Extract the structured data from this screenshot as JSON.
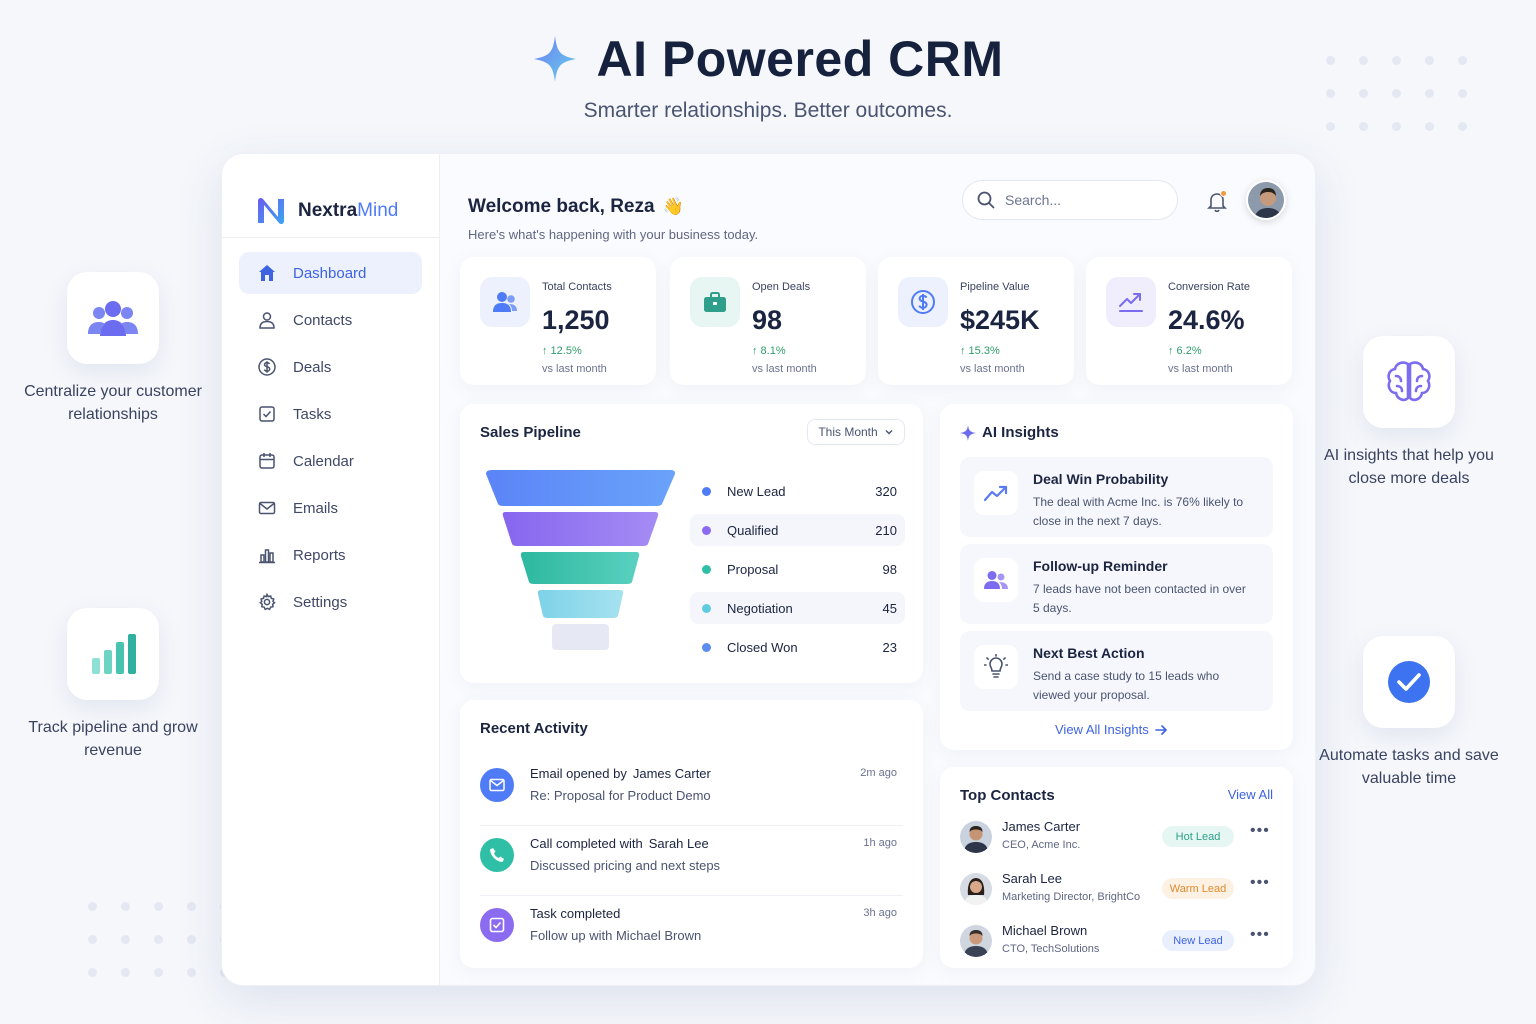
{
  "hero": {
    "title": "AI Powered CRM",
    "subtitle": "Smarter relationships. Better outcomes."
  },
  "features": {
    "centralize": "Centralize your customer relationships",
    "pipeline": "Track pipeline and grow revenue",
    "insights": "AI insights that help you close more deals",
    "automate": "Automate tasks and save valuable time"
  },
  "brand": {
    "name_main": "Nextra",
    "name_accent": "Mind"
  },
  "nav": {
    "items": [
      {
        "label": "Dashboard",
        "icon": "home-icon",
        "active": true
      },
      {
        "label": "Contacts",
        "icon": "user-icon"
      },
      {
        "label": "Deals",
        "icon": "dollar-icon"
      },
      {
        "label": "Tasks",
        "icon": "checkbox-icon"
      },
      {
        "label": "Calendar",
        "icon": "calendar-icon"
      },
      {
        "label": "Emails",
        "icon": "mail-icon"
      },
      {
        "label": "Reports",
        "icon": "bar-chart-icon"
      },
      {
        "label": "Settings",
        "icon": "gear-icon"
      }
    ]
  },
  "header": {
    "welcome": "Welcome back, Reza",
    "welcome_emoji": "👋",
    "subtitle": "Here's what's happening with your business today.",
    "search_placeholder": "Search..."
  },
  "stats": [
    {
      "label": "Total Contacts",
      "value": "1,250",
      "change": "↑ 12.5%",
      "vs": "vs last month",
      "icon": "users-icon"
    },
    {
      "label": "Open Deals",
      "value": "98",
      "change": "↑ 8.1%",
      "vs": "vs last month",
      "icon": "briefcase-icon"
    },
    {
      "label": "Pipeline Value",
      "value": "$245K",
      "change": "↑ 15.3%",
      "vs": "vs last month",
      "icon": "dollar-icon"
    },
    {
      "label": "Conversion Rate",
      "value": "24.6%",
      "change": "↑ 6.2%",
      "vs": "vs last month",
      "icon": "trend-up-icon"
    }
  ],
  "pipeline": {
    "title": "Sales Pipeline",
    "period": "This Month",
    "stages": [
      {
        "name": "New Lead",
        "count": "320",
        "color": "#4f7cf6"
      },
      {
        "name": "Qualified",
        "count": "210",
        "color": "#8b6cf0"
      },
      {
        "name": "Proposal",
        "count": "98",
        "color": "#2fbfa6"
      },
      {
        "name": "Negotiation",
        "count": "45",
        "color": "#5fcbe0"
      },
      {
        "name": "Closed Won",
        "count": "23",
        "color": "#5b8def"
      }
    ]
  },
  "insights": {
    "title": "AI Insights",
    "items": [
      {
        "title": "Deal Win Probability",
        "body": "The deal with Acme Inc. is 76% likely to close in the next 7 days.",
        "icon": "trend-up-icon"
      },
      {
        "title": "Follow-up Reminder",
        "body": "7 leads have not been contacted in over 5 days.",
        "icon": "users-icon"
      },
      {
        "title": "Next Best Action",
        "body": "Send a case study to 15 leads who viewed your proposal.",
        "icon": "lightbulb-icon"
      }
    ],
    "view_all": "View All Insights"
  },
  "activity": {
    "title": "Recent Activity",
    "items": [
      {
        "title": "Email opened by",
        "who": "James Carter",
        "sub": "Re: Proposal for Product Demo",
        "time": "2m ago",
        "icon": "mail-icon",
        "color": "#4f7cf6"
      },
      {
        "title": "Call completed with",
        "who": "Sarah Lee",
        "sub": "Discussed pricing and next steps",
        "time": "1h ago",
        "icon": "phone-icon",
        "color": "#2fbfa6"
      },
      {
        "title": "Task completed",
        "who": "",
        "sub": "Follow up with Michael Brown",
        "time": "3h ago",
        "icon": "check-square-icon",
        "color": "#8b6cf0"
      }
    ]
  },
  "contacts": {
    "title": "Top Contacts",
    "view_all": "View All",
    "items": [
      {
        "name": "James Carter",
        "role": "CEO, Acme Inc.",
        "badge": "Hot Lead",
        "badge_color": "#2f9e8a",
        "badge_bg": "#e6f6f2"
      },
      {
        "name": "Sarah Lee",
        "role": "Marketing Director, BrightCo",
        "badge": "Warm Lead",
        "badge_color": "#e08a2e",
        "badge_bg": "#fdf1e3"
      },
      {
        "name": "Michael Brown",
        "role": "CTO, TechSolutions",
        "badge": "New Lead",
        "badge_color": "#3d63e0",
        "badge_bg": "#e9effd"
      }
    ]
  }
}
